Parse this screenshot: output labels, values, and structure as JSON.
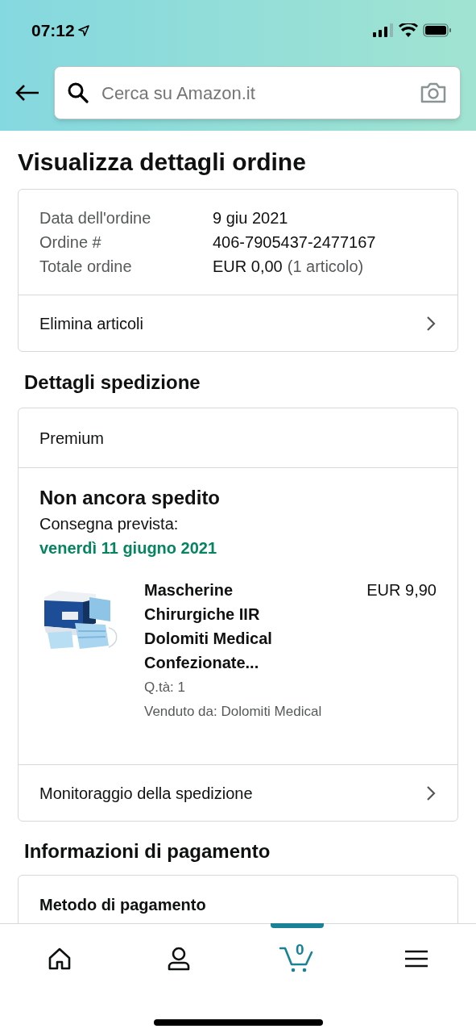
{
  "status_bar": {
    "time": "07:12"
  },
  "search": {
    "placeholder": "Cerca su Amazon.it"
  },
  "page_title": "Visualizza dettagli ordine",
  "order_summary": {
    "rows": [
      {
        "label": "Data dell'ordine",
        "value": "9 giu 2021"
      },
      {
        "label": "Ordine #",
        "value": "406-7905437-2477167"
      },
      {
        "label": "Totale ordine",
        "value": "EUR 0,00",
        "note": "(1 articolo)"
      }
    ],
    "link": "Elimina articoli"
  },
  "shipping": {
    "heading": "Dettagli spedizione",
    "service": "Premium",
    "status": "Non ancora spedito",
    "delivery_label": "Consegna prevista:",
    "delivery_date": "venerdì 11 giugno 2021",
    "item": {
      "title": "Mascherine Chirurgiche IIR Dolomiti Medical Confezionate...",
      "price": "EUR 9,90",
      "quantity": "Q.tà: 1",
      "seller": "Venduto da: Dolomiti Medical"
    },
    "link": "Monitoraggio della spedizione"
  },
  "payment": {
    "heading": "Informazioni di pagamento",
    "method_label": "Metodo di pagamento"
  },
  "tab_bar": [
    {
      "kind": "home",
      "selected": false
    },
    {
      "kind": "account",
      "selected": false
    },
    {
      "kind": "cart",
      "selected": true,
      "count": "0"
    },
    {
      "kind": "menu",
      "selected": false
    }
  ]
}
